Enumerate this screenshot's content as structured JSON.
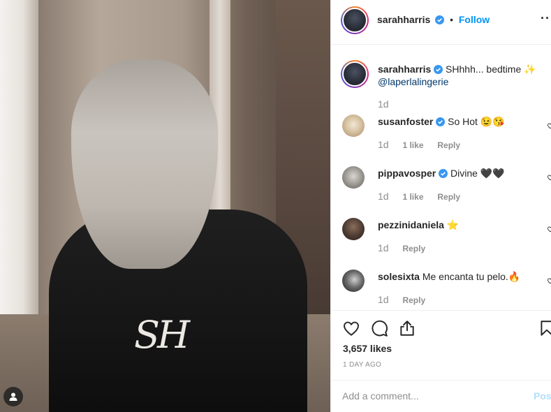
{
  "post": {
    "username": "sarahharris",
    "follow_label": "Follow",
    "dot": "•",
    "more_label": "···",
    "photo_monogram": "SH"
  },
  "caption": {
    "username": "sarahharris",
    "text": " SHhhh... bedtime ✨",
    "mention": "@laperlalingerie",
    "age": "1d"
  },
  "comments": [
    {
      "username": "susanfoster",
      "verified": true,
      "text": " So Hot 😉😘",
      "age": "1d",
      "likes": "1 like",
      "reply": "Reply"
    },
    {
      "username": "pippavosper",
      "verified": true,
      "text": " Divine 🖤🖤",
      "age": "1d",
      "likes": "1 like",
      "reply": "Reply"
    },
    {
      "username": "pezzinidaniela",
      "verified": false,
      "text": " ⭐",
      "age": "1d",
      "likes": "",
      "reply": "Reply"
    },
    {
      "username": "solesixta",
      "verified": false,
      "text": " Me encanta tu pelo.🔥",
      "age": "1d",
      "likes": "",
      "reply": "Reply"
    }
  ],
  "actions": {
    "likes": "3,657 likes",
    "time": "1 DAY AGO"
  },
  "composer": {
    "placeholder": "Add a comment...",
    "post_label": "Post"
  },
  "colors": {
    "accent": "#0095f6",
    "verified": "#3897f0",
    "post_disabled": "#b2dffc"
  },
  "icons": [
    "heart-icon",
    "comment-icon",
    "share-icon",
    "bookmark-icon",
    "verified-icon",
    "user-tag-icon"
  ]
}
